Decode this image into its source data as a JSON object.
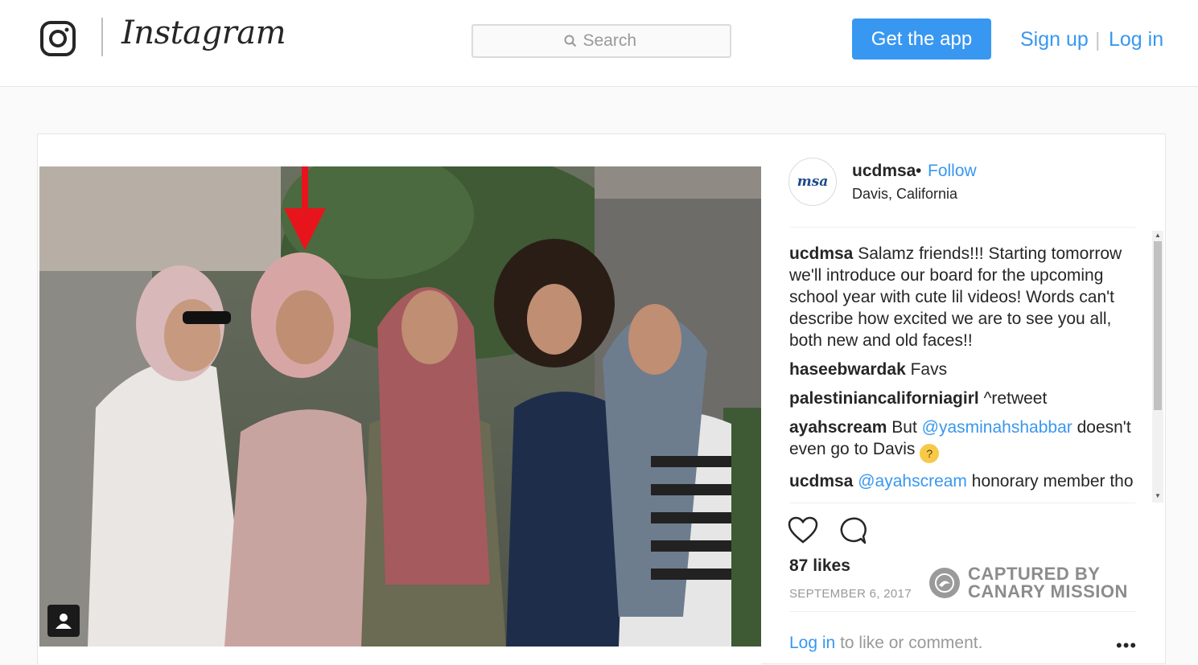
{
  "header": {
    "wordmark": "Instagram",
    "search_placeholder": "Search",
    "get_app_label": "Get the app",
    "signup_label": "Sign up",
    "separator": "|",
    "login_label": "Log in"
  },
  "post": {
    "username": "ucdmsa",
    "dot": "•",
    "follow_label": "Follow",
    "location": "Davis, California",
    "avatar_text": "msa",
    "comments": [
      {
        "user": "ucdmsa",
        "text": "Salamz friends!!! Starting tomorrow we'll introduce our board for the upcoming school year with cute lil videos! Words can't describe how excited we are to see you all, both new and old faces!!"
      },
      {
        "user": "haseebwardak",
        "text": "Favs"
      },
      {
        "user": "palestiniancaliforniagirl",
        "text": "^retweet"
      },
      {
        "user": "ayahscream",
        "pre": "But",
        "mention": "@yasminahshabbar",
        "post": "doesn't even go to Davis"
      },
      {
        "user": "ucdmsa",
        "mention": "@ayahscream",
        "post": "honorary member tho"
      }
    ],
    "likes": "87 likes",
    "date": "SEPTEMBER 6, 2017",
    "watermark_line1": "CAPTURED BY",
    "watermark_line2": "CANARY MISSION",
    "login_link": "Log in",
    "login_suffix": "to like or comment.",
    "more_label": "•••"
  },
  "colors": {
    "accent": "#3897f0",
    "arrow": "#e8141b"
  },
  "icons": [
    "instagram-logo-icon",
    "search-icon",
    "heart-icon",
    "comment-icon",
    "user-tag-icon",
    "canary-logo-icon",
    "red-arrow-icon"
  ]
}
